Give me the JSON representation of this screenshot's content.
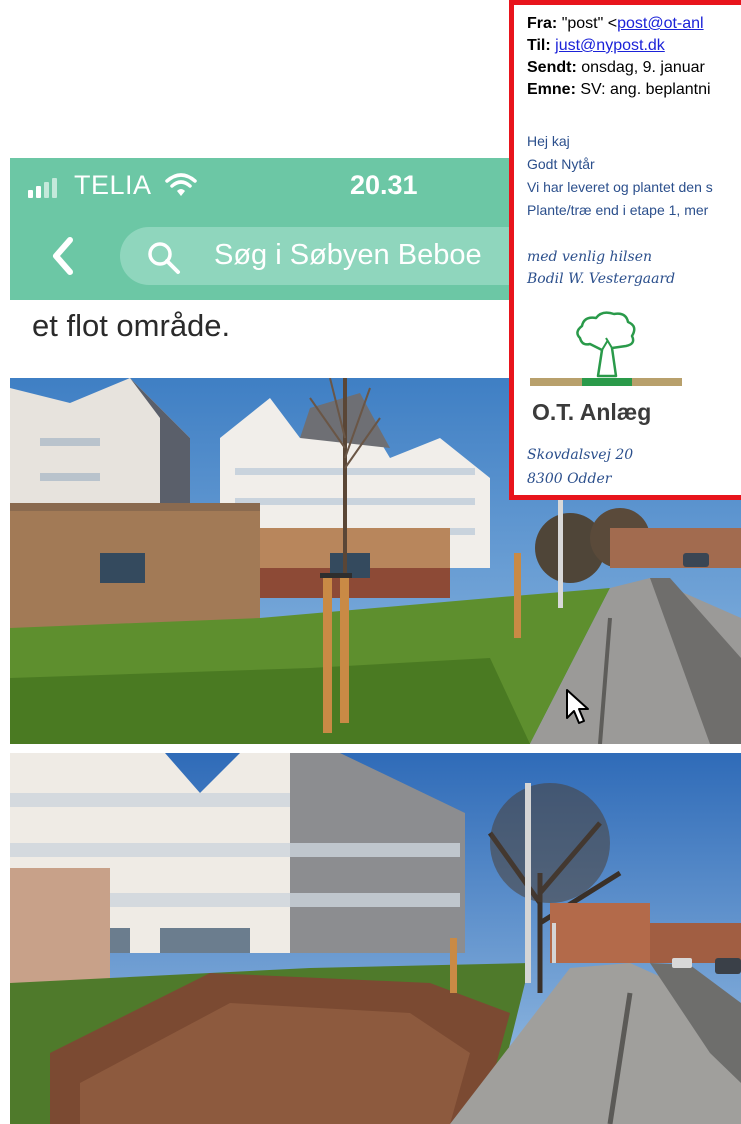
{
  "phone": {
    "carrier": "TELIA",
    "time": "20.31",
    "search_placeholder": "Søg i Søbyen Beboe",
    "article_line": "et flot område.",
    "icons": [
      "signal-icon",
      "wifi-icon",
      "back-chevron-icon",
      "search-icon"
    ],
    "accent_color": "#6cc7a5"
  },
  "email": {
    "from_label": "Fra:",
    "from_name": "\"post\" <",
    "from_address": "post@ot-anl",
    "to_label": "Til:",
    "to_address": "just@nypost.dk",
    "sent_label": "Sendt:",
    "sent_value": "onsdag, 9. januar",
    "subject_label": "Emne:",
    "subject_value": "SV: ang. beplantni",
    "greeting": "Hej kaj",
    "line_newyear": "Godt Nytår",
    "line_delivered": "Vi har leveret og plantet den s",
    "line_plant": "Plante/træ end i etape 1, mer",
    "signoff": "med venlig hilsen",
    "signer": "Bodil W. Vestergaard",
    "company": "O.T. Anlæg",
    "address_street": "Skovdalsvej 20",
    "address_city": "8300 Odder",
    "border_color": "#e8141c"
  }
}
